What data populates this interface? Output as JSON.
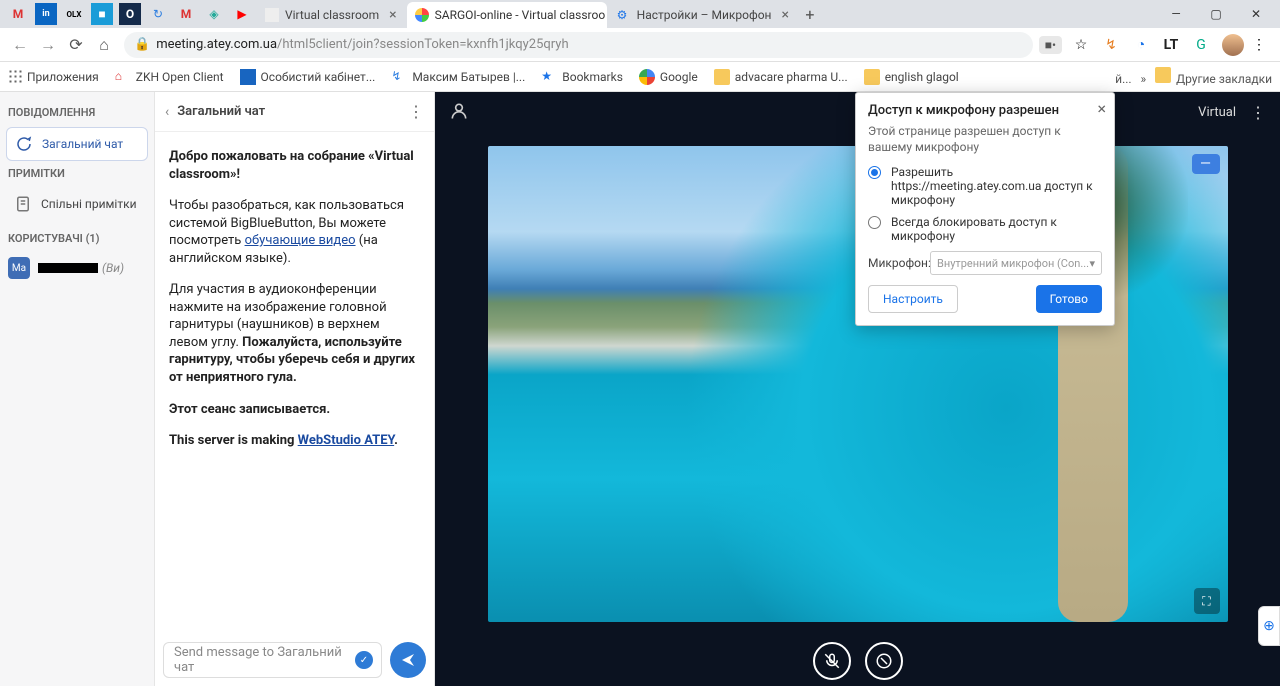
{
  "browser": {
    "pinnedIcons": [
      "M",
      "in",
      "OLX",
      "■",
      "O",
      "↻",
      "M",
      "◈",
      "▶"
    ],
    "tabs": [
      {
        "title": "Virtual classroom",
        "active": false
      },
      {
        "title": "SARGOI-online - Virtual classroo",
        "active": true
      },
      {
        "title": "Настройки – Микрофон",
        "active": false
      }
    ],
    "windowControls": {
      "min": "—",
      "max": "▢",
      "close": "✕"
    },
    "nav": {
      "back": "←",
      "fwd": "→",
      "reload": "⟳",
      "home": "⌂"
    },
    "url": {
      "domain": "meeting.atey.com.ua",
      "path": "/html5client/join?sessionToken=kxnfh1jkqy25qryh"
    },
    "cameraIndicator": "■•",
    "star": "☆",
    "extensions": [
      "↯",
      "◔",
      "LT",
      "G"
    ],
    "menu": "⋮"
  },
  "bookmarks": {
    "apps": "Приложения",
    "items": [
      "ZKH Open Client",
      "Особистий кабінет...",
      "Максим Батырев |...",
      "Bookmarks",
      "Google",
      "advacare pharma U...",
      "english glagol"
    ],
    "truncated": "й...",
    "more": "»",
    "other": "Другие закладки"
  },
  "left": {
    "hdrMessages": "ПОВІДОМЛЕННЯ",
    "itemChat": "Загальний чат",
    "hdrNotes": "ПРИМІТКИ",
    "itemNotes": "Спільні примітки",
    "hdrUsers": "КОРИСТУВАЧІ (1)",
    "user": {
      "initials": "Ma",
      "suffix": "(Ви)"
    }
  },
  "chat": {
    "title": "Загальний чат",
    "p1a": "Добро пожаловать на собрание «Virtual classroom»!",
    "p2a": "Чтобы разобраться, как пользоваться системой BigBlueButton, Вы можете посмотреть ",
    "p2link": "обучающие видео",
    "p2b": " (на английском языке).",
    "p3a": "Для участия в аудиоконференции нажмите на изображение головной гарнитуры (наушников) в верхнем левом углу. ",
    "p3b": "Пожалуйста, используйте гарнитуру, чтобы уберечь себя и других от неприятного гула.",
    "p4": "Этот сеанс записывается.",
    "p5a": "This server is making ",
    "p5link": "WebStudio ATEY",
    "p5b": ".",
    "placeholder": "Send message to Загальний чат"
  },
  "stage": {
    "title": "Virtual"
  },
  "perm": {
    "title": "Доступ к микрофону разрешен",
    "sub": "Этой странице разрешен доступ к вашему микрофону",
    "opt1": "Разрешить https://meeting.atey.com.ua доступ к микрофону",
    "opt2": "Всегда блокировать доступ к микрофону",
    "selLabel": "Микрофон:",
    "selValue": "Внутренний микрофон (Con...",
    "btnSettings": "Настроить",
    "btnDone": "Готово"
  }
}
